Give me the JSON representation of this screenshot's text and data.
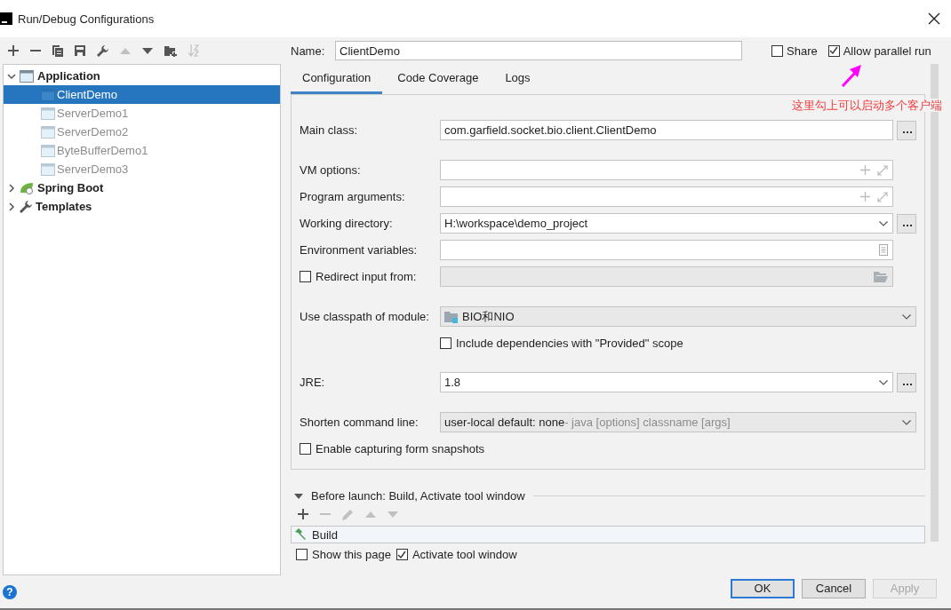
{
  "window": {
    "title": "Run/Debug Configurations"
  },
  "toolbar": {
    "items": [
      {
        "kind": "add",
        "disabled": false
      },
      {
        "kind": "remove",
        "disabled": false
      },
      {
        "kind": "copy",
        "disabled": false
      },
      {
        "kind": "save",
        "disabled": false
      },
      {
        "kind": "wrench",
        "disabled": false
      },
      {
        "kind": "up",
        "disabled": true
      },
      {
        "kind": "down",
        "disabled": false
      },
      {
        "kind": "folder",
        "disabled": false
      },
      {
        "kind": "sort",
        "disabled": true
      }
    ]
  },
  "tree": [
    {
      "label": "Application",
      "kind": "application",
      "expanded": true,
      "children": [
        {
          "label": "ClientDemo",
          "selected": true,
          "temporary": false
        },
        {
          "label": "ServerDemo1",
          "selected": false,
          "temporary": true
        },
        {
          "label": "ServerDemo2",
          "selected": false,
          "temporary": true
        },
        {
          "label": "ByteBufferDemo1",
          "selected": false,
          "temporary": true
        },
        {
          "label": "ServerDemo3",
          "selected": false,
          "temporary": true
        }
      ]
    },
    {
      "label": "Spring Boot",
      "kind": "spring",
      "expanded": false
    },
    {
      "label": "Templates",
      "kind": "templates",
      "expanded": false
    }
  ],
  "name": {
    "label": "Name:",
    "value": "ClientDemo"
  },
  "options": [
    {
      "label": "Share",
      "checked": false
    },
    {
      "label": "Allow parallel run",
      "checked": true
    }
  ],
  "annotation": {
    "text": "这里勾上可以启动多个客户端"
  },
  "tabs": [
    {
      "label": "Configuration",
      "selected": true
    },
    {
      "label": "Code Coverage",
      "selected": false
    },
    {
      "label": "Logs",
      "selected": false
    }
  ],
  "groups": [
    [
      {
        "kind": "text",
        "label": "Main class:",
        "value": "com.garfield.socket.bio.client.ClientDemo",
        "browse": true
      }
    ],
    [
      {
        "kind": "expand",
        "label": "VM options:"
      },
      {
        "kind": "expand",
        "label": "Program arguments:"
      },
      {
        "kind": "combo",
        "label": "Working directory:",
        "value": "H:\\workspace\\demo_project",
        "browse": true
      },
      {
        "kind": "env",
        "label": "Environment variables:"
      },
      {
        "kind": "redirect",
        "label": "Redirect input from:",
        "checked": false
      }
    ],
    [
      {
        "kind": "module",
        "label": "Use classpath of module:",
        "value": "BIO和NIO"
      },
      {
        "kind": "check",
        "label": "Include dependencies with \"Provided\" scope",
        "checked": false
      }
    ],
    [
      {
        "kind": "combo",
        "label": "JRE:",
        "value": "1.8",
        "browse": true
      }
    ],
    [
      {
        "kind": "shorten",
        "label": "Shorten command line:",
        "value": "user-local default: none",
        "hint": "- java [options] classname [args]"
      },
      {
        "kind": "check-left",
        "label": "Enable capturing form snapshots",
        "checked": false
      }
    ]
  ],
  "before_launch": {
    "title": "Before launch: Build, Activate tool window",
    "expanded": true,
    "tasks": [
      "Build"
    ],
    "checks": [
      {
        "label": "Show this page",
        "checked": false
      },
      {
        "label": "Activate tool window",
        "checked": true
      }
    ]
  },
  "help": {
    "label": "?"
  },
  "buttons": [
    {
      "label": "OK",
      "kind": "default",
      "disabled": false
    },
    {
      "label": "Cancel",
      "kind": "normal",
      "disabled": false
    },
    {
      "label": "Apply",
      "kind": "normal",
      "disabled": true
    }
  ]
}
